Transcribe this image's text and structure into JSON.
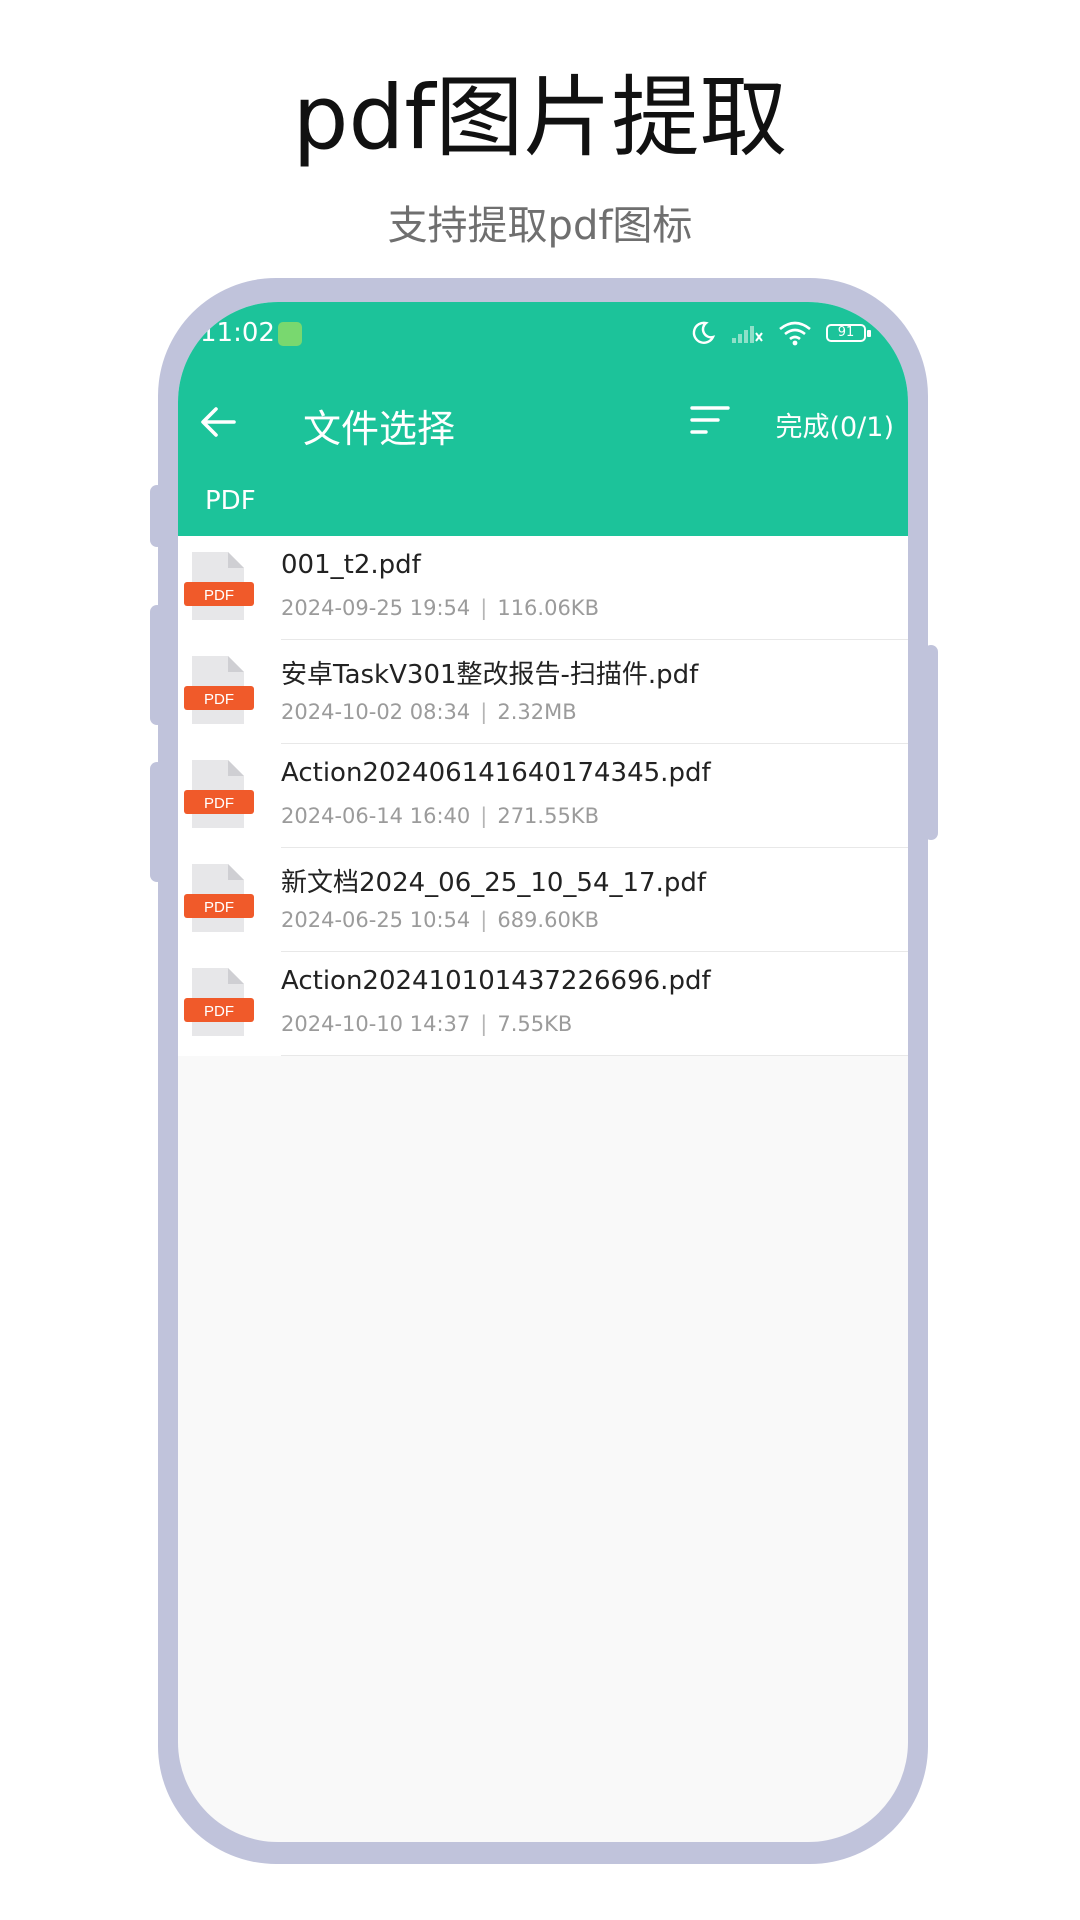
{
  "promo": {
    "title": "pdf图片提取",
    "subtitle": "支持提取pdf图标"
  },
  "status_bar": {
    "time": "11:02",
    "battery": "91"
  },
  "toolbar": {
    "title": "文件选择",
    "done_label": "完成(0/1)"
  },
  "tabs": {
    "active": "PDF"
  },
  "colors": {
    "accent": "#1cc39a",
    "frame": "#c0c3db",
    "pdf_badge": "#f05a2a"
  },
  "files": [
    {
      "name": "001_t2.pdf",
      "date": "2024-09-25 19:54",
      "size": "116.06KB",
      "icon_label": "PDF"
    },
    {
      "name": "安卓TaskV301整改报告-扫描件.pdf",
      "date": "2024-10-02 08:34",
      "size": "2.32MB",
      "icon_label": "PDF"
    },
    {
      "name": "Action202406141640174345.pdf",
      "date": "2024-06-14 16:40",
      "size": "271.55KB",
      "icon_label": "PDF"
    },
    {
      "name": "新文档2024_06_25_10_54_17.pdf",
      "date": "2024-06-25 10:54",
      "size": "689.60KB",
      "icon_label": "PDF"
    },
    {
      "name": "Action202410101437226696.pdf",
      "date": "2024-10-10 14:37",
      "size": "7.55KB",
      "icon_label": "PDF"
    }
  ],
  "meta_separator": "|"
}
